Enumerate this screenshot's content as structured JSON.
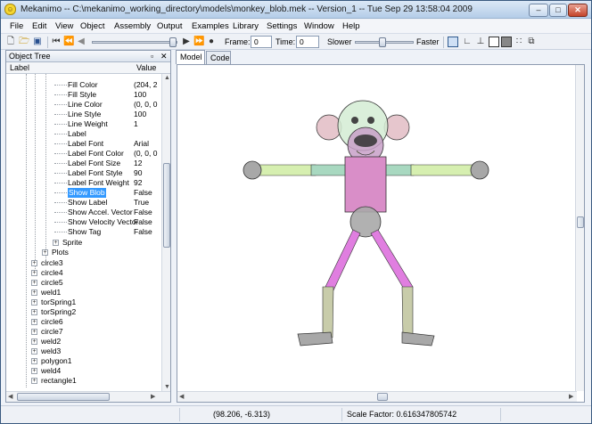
{
  "window": {
    "title": "Mekanimo  --  C:\\mekanimo_working_directory\\models\\monkey_blob.mek  --  Version_1  --  Tue Sep 29 13:58:04 2009",
    "controls": {
      "minimize": "–",
      "maximize": "□",
      "close": "✕"
    }
  },
  "menu": [
    "File",
    "Edit",
    "View",
    "Object",
    "Assembly",
    "Output",
    "Examples",
    "Library",
    "Settings",
    "Window",
    "Help"
  ],
  "toolbar": {
    "frame_label": "Frame:",
    "frame_value": "0",
    "time_label": "Time:",
    "time_value": "0",
    "slower_label": "Slower",
    "faster_label": "Faster"
  },
  "object_tree": {
    "title": "Object Tree",
    "col_label": "Label",
    "col_value": "Value",
    "properties": [
      {
        "label": "Fill Color",
        "value": "(204, 2"
      },
      {
        "label": "Fill Style",
        "value": "100"
      },
      {
        "label": "Line Color",
        "value": "(0, 0, 0"
      },
      {
        "label": "Line Style",
        "value": "100"
      },
      {
        "label": "Line Weight",
        "value": "1"
      },
      {
        "label": "Label",
        "value": ""
      },
      {
        "label": "Label Font",
        "value": "Arial"
      },
      {
        "label": "Label Font Color",
        "value": "(0, 0, 0"
      },
      {
        "label": "Label Font Size",
        "value": "12"
      },
      {
        "label": "Label Font Style",
        "value": "90"
      },
      {
        "label": "Label Font Weight",
        "value": "92"
      },
      {
        "label": "Show Blob",
        "value": "False",
        "selected": true
      },
      {
        "label": "Show Label",
        "value": "True"
      },
      {
        "label": "Show Accel. Vector",
        "value": "False"
      },
      {
        "label": "Show Velocity Vector",
        "value": "False"
      },
      {
        "label": "Show Tag",
        "value": "False"
      }
    ],
    "sprite": "Sprite",
    "plots": "Plots",
    "objects": [
      "circle3",
      "circle4",
      "circle5",
      "weld1",
      "torSpring1",
      "torSpring2",
      "circle6",
      "circle7",
      "weld2",
      "weld3",
      "polygon1",
      "weld4",
      "rectangle1"
    ]
  },
  "tabs": [
    "Model",
    "Code"
  ],
  "status": {
    "coords": "(98.206, -6.313)",
    "scale": "Scale Factor: 0.616347805742"
  },
  "colors": {
    "selection": "#3399ff",
    "body_pink": "#d98ec8",
    "limb_magenta": "#e07ee0",
    "arm_green": "#d6efb0",
    "leg_olive": "#c8ccaa",
    "head_green": "#d4ecd4",
    "ear_pink": "#e0b8c0",
    "joint_gray": "#a8a8a8"
  }
}
